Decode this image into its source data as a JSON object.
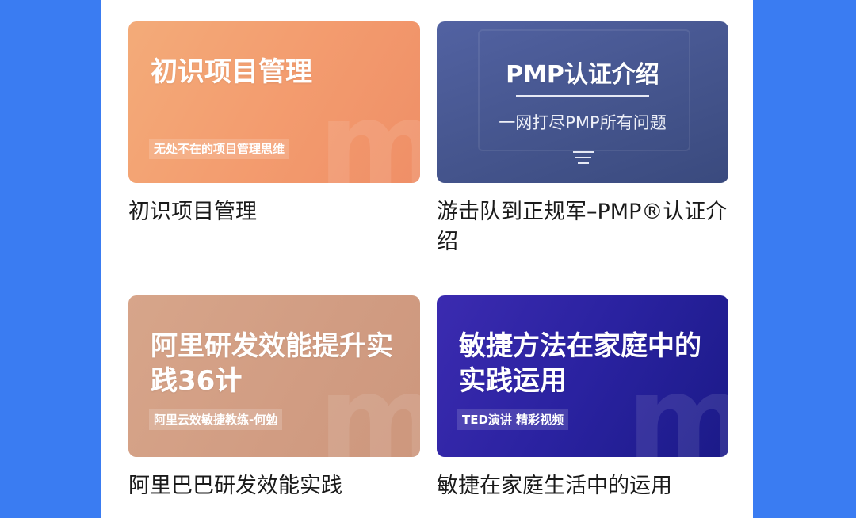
{
  "courses": [
    {
      "thumb_title": "初识项目管理",
      "thumb_subtitle": "无处不在的项目管理思维",
      "title": "初识项目管理"
    },
    {
      "thumb_title": "PMP认证介绍",
      "thumb_subtitle": "一网打尽PMP所有问题",
      "title": "游击队到正规军–PMP®认证介绍"
    },
    {
      "thumb_title": "阿里研发效能提升实践36计",
      "thumb_subtitle": "阿里云效敏捷教练-何勉",
      "title": "阿里巴巴研发效能实践"
    },
    {
      "thumb_title": "敏捷方法在家庭中的实践运用",
      "thumb_subtitle": "TED演讲 精彩视频",
      "title": "敏捷在家庭生活中的运用"
    }
  ],
  "colors": {
    "page_background": "#3a7cf2",
    "panel_background": "#ffffff"
  }
}
